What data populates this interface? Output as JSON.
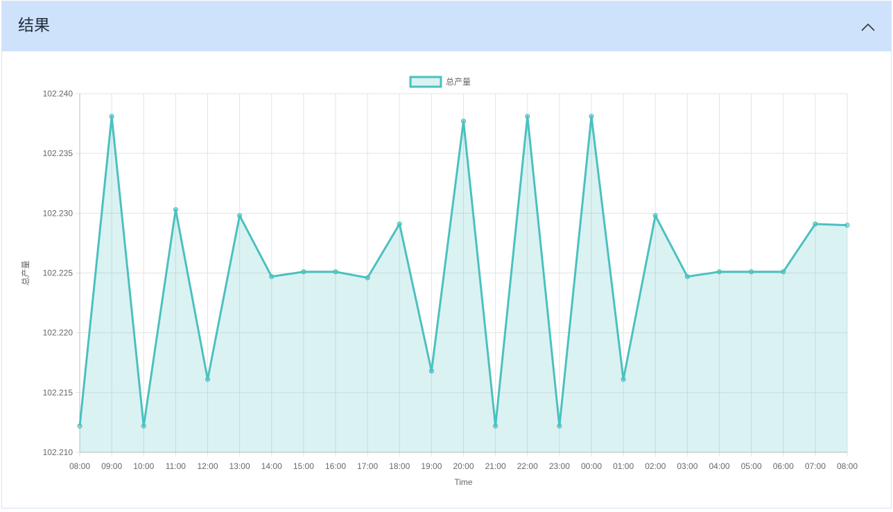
{
  "panel": {
    "title": "结果",
    "collapse_icon": "chevron-up-icon"
  },
  "colors": {
    "header_bg": "#cfe2fc",
    "line": "#4bc0c0",
    "fill": "rgba(75,192,192,0.2)",
    "grid": "#e3e3e3",
    "text": "#666666"
  },
  "chart_data": {
    "type": "area",
    "legend": [
      "总产量"
    ],
    "legend_position": "top",
    "xlabel": "Time",
    "ylabel": "总产量",
    "ylim": [
      102.21,
      102.24
    ],
    "yticks": [
      "102.210",
      "102.215",
      "102.220",
      "102.225",
      "102.230",
      "102.235",
      "102.240"
    ],
    "grid": true,
    "categories": [
      "08:00",
      "09:00",
      "10:00",
      "11:00",
      "12:00",
      "13:00",
      "14:00",
      "15:00",
      "16:00",
      "17:00",
      "18:00",
      "19:00",
      "20:00",
      "21:00",
      "22:00",
      "23:00",
      "00:00",
      "01:00",
      "02:00",
      "03:00",
      "04:00",
      "05:00",
      "06:00",
      "07:00",
      "08:00"
    ],
    "series": [
      {
        "name": "总产量",
        "values": [
          102.2122,
          102.2381,
          102.2122,
          102.2303,
          102.2161,
          102.2298,
          102.2247,
          102.2251,
          102.2251,
          102.2246,
          102.2291,
          102.2168,
          102.2377,
          102.2122,
          102.2381,
          102.2122,
          102.2381,
          102.2161,
          102.2298,
          102.2247,
          102.2251,
          102.2251,
          102.2251,
          102.2291,
          102.229
        ]
      }
    ]
  }
}
